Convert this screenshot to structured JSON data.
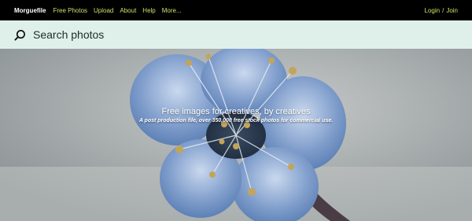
{
  "nav": {
    "brand": "Morguefile",
    "links": [
      "Free Photos",
      "Upload",
      "About",
      "Help",
      "More..."
    ],
    "login": "Login",
    "separator": "/",
    "join": "Join"
  },
  "search": {
    "placeholder": "Search photos",
    "icon": "search-icon"
  },
  "hero": {
    "title": "Free images for creatives, by creatives",
    "subtitle": "A post production file, over 350,000 free stock photos for commercial use."
  },
  "colors": {
    "nav_bg": "#000000",
    "link_accent": "#cde06a",
    "search_bg": "#dff0ea",
    "petal_blue": "#6f8fc2"
  }
}
